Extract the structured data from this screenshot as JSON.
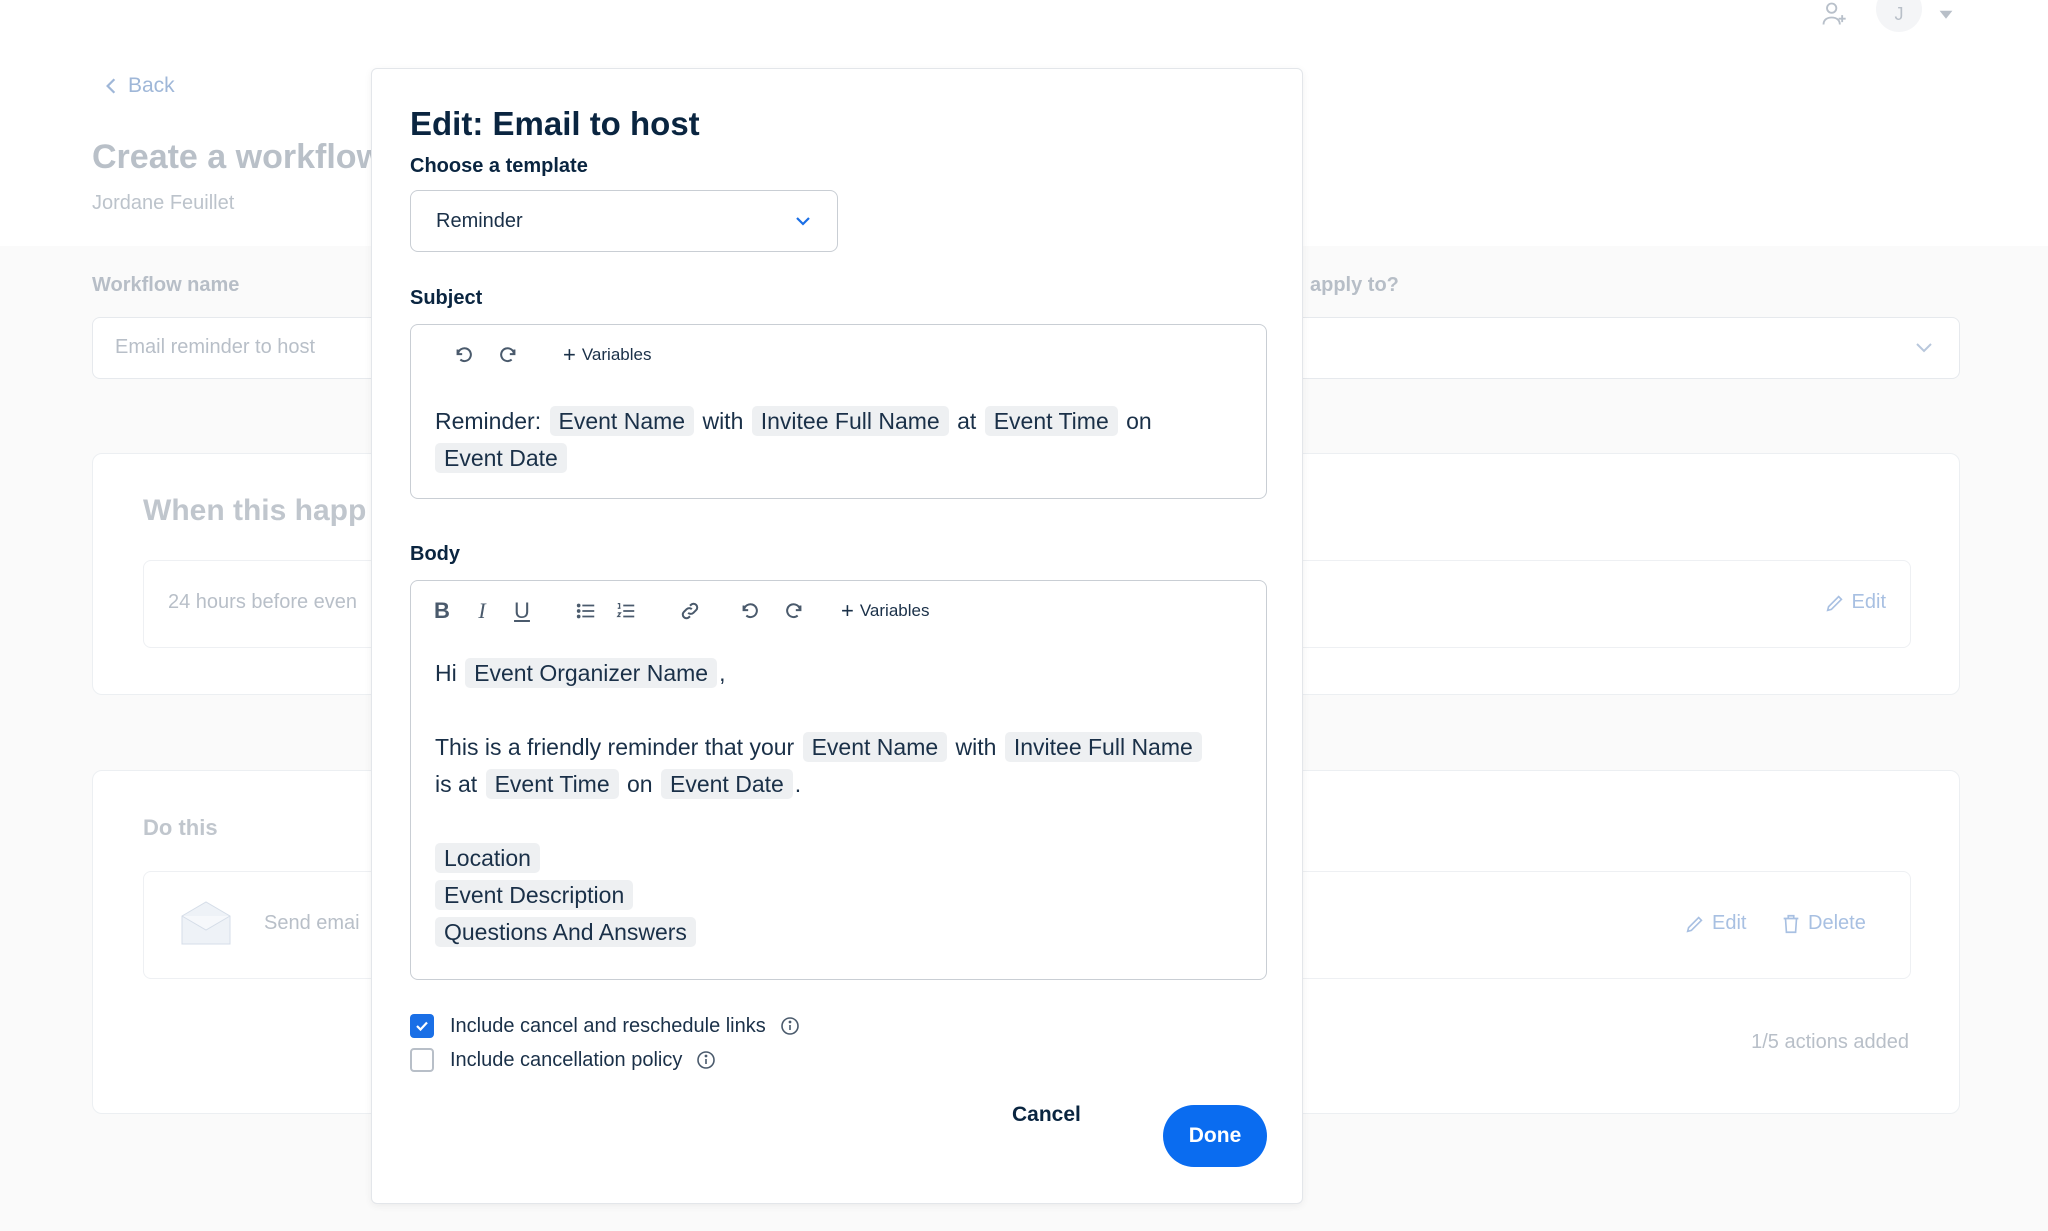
{
  "background": {
    "back_label": "Back",
    "page_title": "Create a workflow",
    "owner": "Jordane Feuillet",
    "workflow_name_label": "Workflow name",
    "workflow_name_value": "Email reminder to host",
    "apply_label_partial": "apply to?",
    "when_heading": "When this happ",
    "trigger_text": "24 hours before even",
    "trigger_edit": "Edit",
    "do_heading": "Do this",
    "action_text": "Send emai",
    "action_edit": "Edit",
    "action_delete": "Delete",
    "actions_count": "1/5 actions added",
    "avatar_initial": "J"
  },
  "modal": {
    "title": "Edit: Email to host",
    "template_label": "Choose a template",
    "template_value": "Reminder",
    "subject_label": "Subject",
    "variables_label": "Variables",
    "subject": {
      "prefix": "Reminder:",
      "var1": "Event Name",
      "w1": "with",
      "var2": "Invitee Full Name",
      "w2": "at",
      "var3": "Event Time",
      "w3": "on",
      "var4": "Event Date"
    },
    "body_label": "Body",
    "body": {
      "greeting": "Hi",
      "organizer": "Event Organizer Name",
      "comma": ",",
      "line1": "This is a friendly reminder that your",
      "event_name": "Event Name",
      "with": "with",
      "invitee": "Invitee Full Name",
      "is_at": "is at",
      "event_time": "Event Time",
      "on": "on",
      "event_date": "Event Date",
      "period": ".",
      "location": "Location",
      "description": "Event Description",
      "qa": "Questions And Answers"
    },
    "checkbox1_label": "Include cancel and reschedule links",
    "checkbox1_checked": true,
    "checkbox2_label": "Include cancellation policy",
    "checkbox2_checked": false,
    "cancel_label": "Cancel",
    "done_label": "Done"
  },
  "colors": {
    "primary": "#0a6cf0",
    "text": "#0a2540",
    "pill": "#eef0f2"
  }
}
